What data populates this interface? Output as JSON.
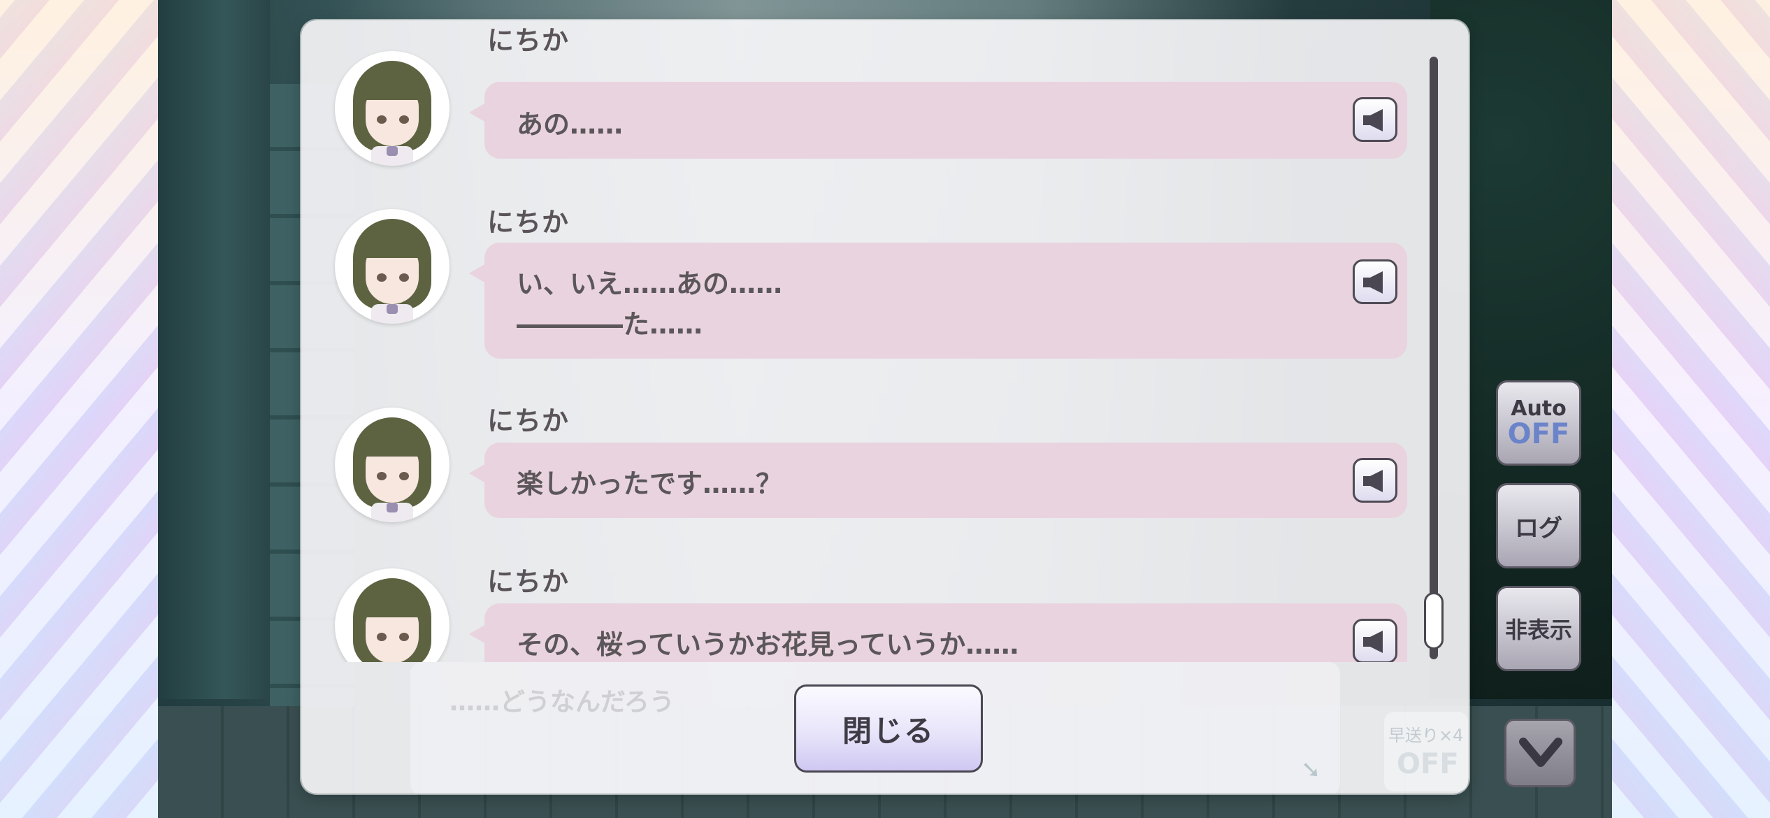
{
  "log": {
    "entries": [
      {
        "speaker": "にちか",
        "lines": [
          "あの……"
        ]
      },
      {
        "speaker": "にちか",
        "lines": [
          "い、いえ……あの……",
          "――――た……"
        ]
      },
      {
        "speaker": "にちか",
        "lines": [
          "楽しかったです……？"
        ]
      },
      {
        "speaker": "にちか",
        "lines": [
          "その、桜っていうかお花見っていうか……"
        ]
      }
    ],
    "close_label": "閉じる"
  },
  "background_message": "……どうなんだろう",
  "fast_forward": {
    "label": "早送り×4",
    "state": "OFF"
  },
  "side_menu": {
    "auto_label": "Auto",
    "auto_state": "OFF",
    "log_label": "ログ",
    "hide_label": "非表示"
  },
  "colors": {
    "bubble": "#e9d3df",
    "panel": "#faf8fb",
    "auto_off": "#6b84c9",
    "close_button": "#e8e5fa"
  },
  "icons": [
    "speaker-icon",
    "chevron-down-icon"
  ]
}
